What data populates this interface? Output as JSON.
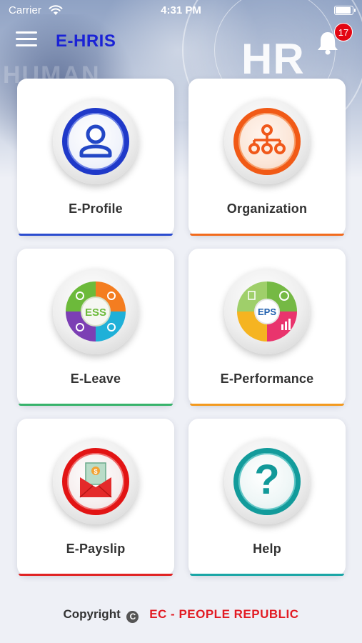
{
  "status_bar": {
    "carrier": "Carrier",
    "time": "4:31 PM",
    "battery_level": 1.0
  },
  "app_bar": {
    "title": "E-HRIS",
    "title_color": "#1a22d6",
    "menu_icon": "hamburger-icon",
    "notification_icon": "bell-icon",
    "notification_count": "17",
    "badge_color": "#e30613"
  },
  "hero": {
    "watermark": "HUMAN",
    "logo_text": "HR"
  },
  "tiles": [
    {
      "label": "E-Profile",
      "icon": "user-profile-icon",
      "accent": "#2b4ccf"
    },
    {
      "label": "Organization",
      "icon": "org-chart-icon",
      "accent": "#f26b1d"
    },
    {
      "label": "E-Leave",
      "icon": "ess-cycle-icon",
      "icon_text": "ESS",
      "accent": "#37b36b"
    },
    {
      "label": "E-Performance",
      "icon": "eps-puzzle-icon",
      "icon_text": "EPS",
      "accent": "#f39a1f"
    },
    {
      "label": "E-Payslip",
      "icon": "payslip-envelope-icon",
      "accent": "#e02323"
    },
    {
      "label": "Help",
      "icon": "question-mark-icon",
      "icon_text": "?",
      "accent": "#1aa6a6"
    }
  ],
  "footer": {
    "copyright": "Copyright",
    "copyright_symbol": "C",
    "company": "EC - PEOPLE REPUBLIC",
    "company_color": "#e21b23"
  }
}
